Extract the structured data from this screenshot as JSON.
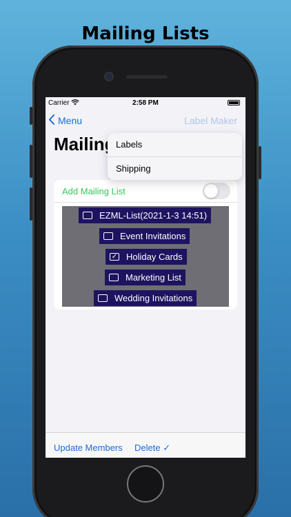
{
  "headline": "Mailing Lists",
  "status_bar": {
    "carrier": "Carrier",
    "time": "2:58 PM",
    "wifi_icon": "wifi-icon",
    "battery_icon": "battery-icon"
  },
  "nav": {
    "back_label": "Menu",
    "right_title": "Label Maker"
  },
  "page_title": "Mailing",
  "popup_menu": {
    "items": [
      "Labels",
      "Shipping"
    ]
  },
  "add_row": {
    "label": "Add Mailing List",
    "toggle_on": false
  },
  "mailing_lists": [
    {
      "name": "EZML-List(2021-1-3 14:51)",
      "checked": false
    },
    {
      "name": "Event Invitations",
      "checked": false
    },
    {
      "name": "Holiday Cards",
      "checked": true
    },
    {
      "name": "Marketing List",
      "checked": false
    },
    {
      "name": "Wedding Invitations",
      "checked": false
    }
  ],
  "toolbar": {
    "update_label": "Update Members",
    "delete_label": "Delete ✓"
  },
  "colors": {
    "accent_blue": "#1b6bd6",
    "accent_green": "#34c759",
    "list_item_bg": "#1e1360",
    "panel_bg": "#6e6e74"
  }
}
